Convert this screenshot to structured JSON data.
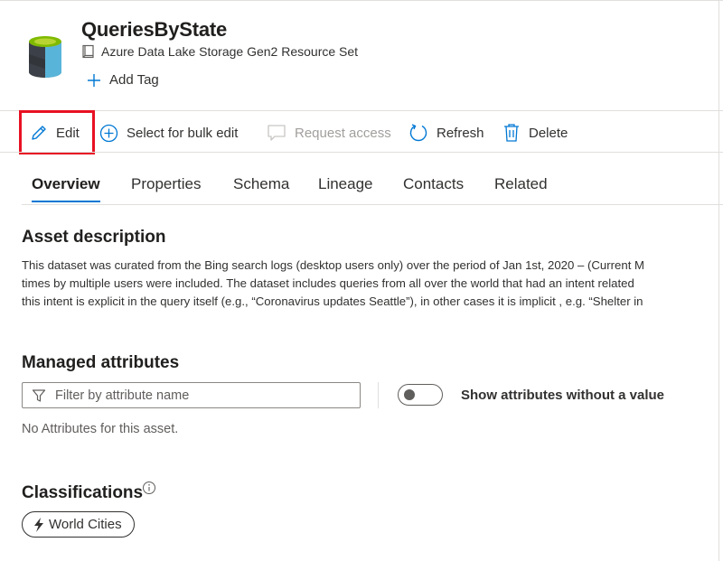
{
  "asset": {
    "title": "QueriesByState",
    "type": "Azure Data Lake Storage Gen2 Resource Set",
    "add_tag_label": "Add Tag"
  },
  "toolbar": {
    "edit": "Edit",
    "bulk_edit": "Select for bulk edit",
    "request_access": "Request access",
    "refresh": "Refresh",
    "delete": "Delete"
  },
  "tabs": [
    "Overview",
    "Properties",
    "Schema",
    "Lineage",
    "Contacts",
    "Related"
  ],
  "active_tab": "Overview",
  "description": {
    "heading": "Asset description",
    "lines": [
      "This dataset was curated from the Bing search logs (desktop users only) over the period of Jan 1st, 2020 – (Current M",
      "times by multiple users were included. The dataset includes queries from all over the world that had an intent related",
      "this intent is explicit in the query itself (e.g., “Coronavirus updates Seattle”), in other cases it is implicit , e.g. “Shelter in"
    ]
  },
  "managed_attributes": {
    "heading": "Managed attributes",
    "filter_placeholder": "Filter by attribute name",
    "toggle_label": "Show attributes without a value",
    "toggle_on": false,
    "empty_message": "No Attributes for this asset."
  },
  "classifications": {
    "heading": "Classifications",
    "items": [
      "World Cities"
    ]
  },
  "colors": {
    "accent": "#0078d4",
    "highlight": "#e81123",
    "icon_green": "#7fba00"
  }
}
